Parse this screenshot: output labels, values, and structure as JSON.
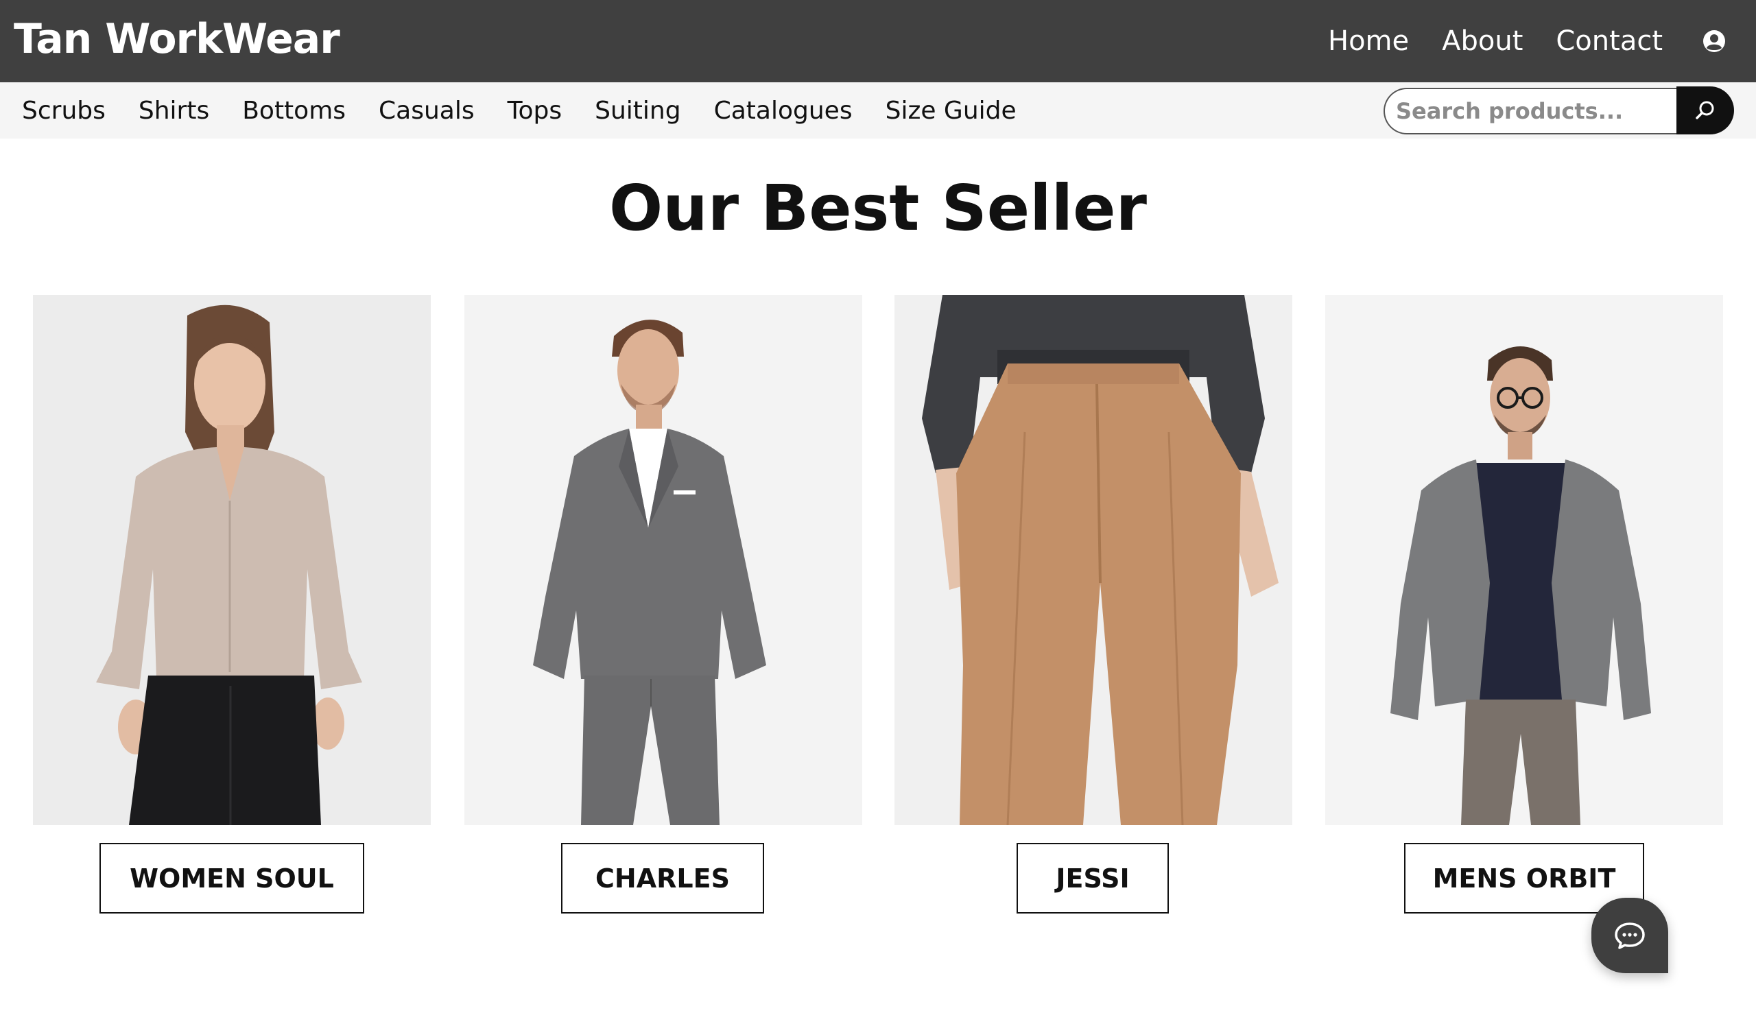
{
  "brand": "Tan WorkWear",
  "top_nav": [
    "Home",
    "About",
    "Contact"
  ],
  "icons": {
    "account": "user-circle-icon",
    "search": "search-icon",
    "chat": "chat-bubble-icon"
  },
  "categories": [
    "Scrubs",
    "Shirts",
    "Bottoms",
    "Casuals",
    "Tops",
    "Suiting",
    "Catalogues",
    "Size Guide"
  ],
  "search": {
    "placeholder": "Search products...",
    "value": ""
  },
  "section_title": "Our Best Seller",
  "products": [
    {
      "label": "WOMEN SOUL",
      "image": "woman in taupe blouse and black trousers"
    },
    {
      "label": "CHARLES",
      "image": "man in grey check suit with white shirt"
    },
    {
      "label": "JESSI",
      "image": "tan tailored trousers with dark grey shirt"
    },
    {
      "label": "MENS ORBIT",
      "image": "man with glasses in grey blazer and navy henley"
    }
  ],
  "colors": {
    "header_bg": "#404040",
    "category_bar_bg": "#f5f5f5",
    "search_button_bg": "#111111",
    "chat_button_bg": "#3f3f3f"
  }
}
